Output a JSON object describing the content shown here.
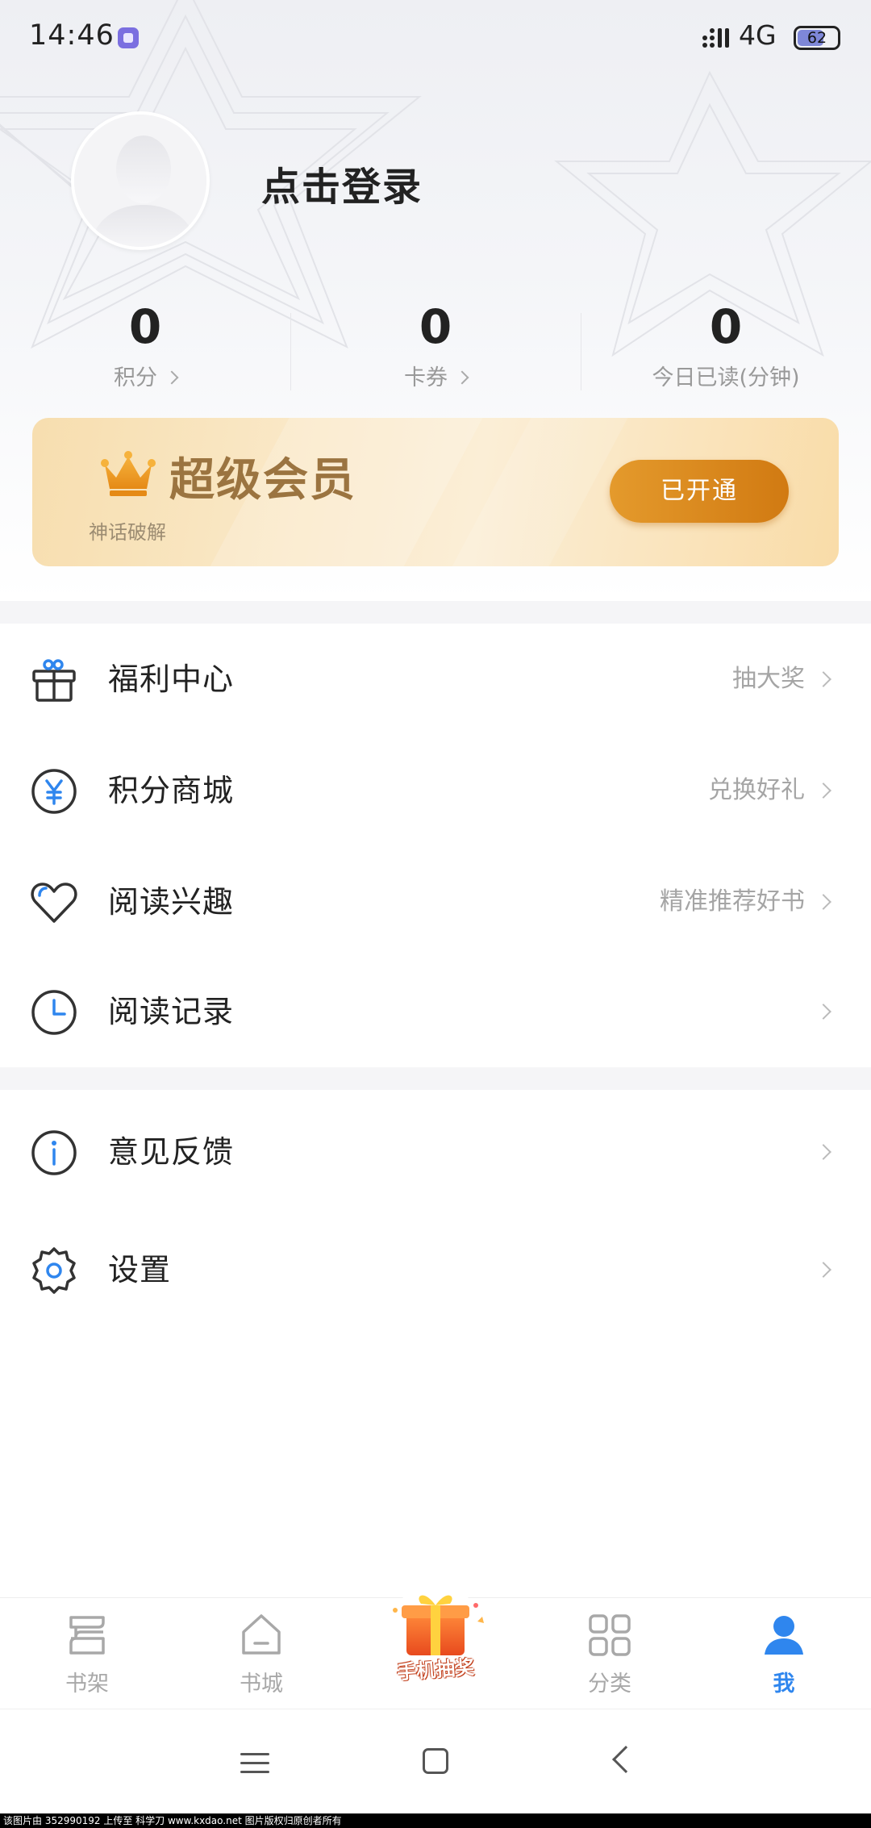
{
  "status_bar": {
    "time": "14:46",
    "network": "4G",
    "battery": "62",
    "battery_level": 0.62
  },
  "profile": {
    "login_text": "点击登录"
  },
  "stats": [
    {
      "value": "0",
      "label": "积分",
      "has_chevron": true
    },
    {
      "value": "0",
      "label": "卡券",
      "has_chevron": true
    },
    {
      "value": "0",
      "label": "今日已读(分钟)",
      "has_chevron": false
    }
  ],
  "vip": {
    "title": "超级会员",
    "subtitle": "神话破解",
    "button_label": "已开通"
  },
  "menu_group_1": [
    {
      "icon": "gift-icon",
      "label": "福利中心",
      "sub": "抽大奖"
    },
    {
      "icon": "yuan-icon",
      "label": "积分商城",
      "sub": "兑换好礼"
    },
    {
      "icon": "heart-icon",
      "label": "阅读兴趣",
      "sub": "精准推荐好书"
    },
    {
      "icon": "clock-icon",
      "label": "阅读记录",
      "sub": ""
    }
  ],
  "menu_group_2": [
    {
      "icon": "info-icon",
      "label": "意见反馈",
      "sub": ""
    },
    {
      "icon": "gear-icon",
      "label": "设置",
      "sub": ""
    }
  ],
  "tab_bar": {
    "tabs": [
      {
        "icon": "bookshelf-icon",
        "label": "书架",
        "active": false
      },
      {
        "icon": "bookstore-icon",
        "label": "书城",
        "active": false
      },
      {
        "icon": "lottery-icon",
        "label": "手机抽奖",
        "active": false
      },
      {
        "icon": "category-icon",
        "label": "分类",
        "active": false
      },
      {
        "icon": "user-icon",
        "label": "我",
        "active": true
      }
    ]
  },
  "colors": {
    "accent": "#2f86ee",
    "vip_button": "#d98520",
    "vip_title": "#9b7440",
    "icon_blue": "#2f86ee"
  },
  "watermark": "该图片由 352990192 上传至 科学刀 www.kxdao.net 图片版权归原创者所有"
}
